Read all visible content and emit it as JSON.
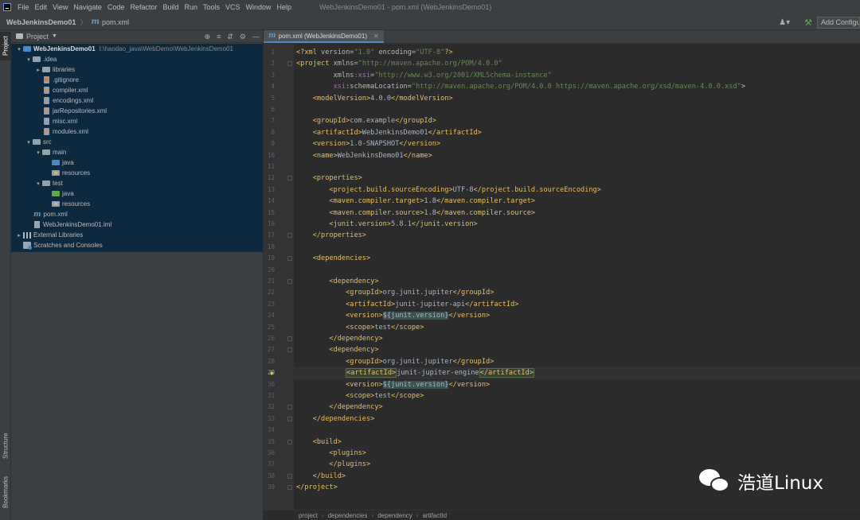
{
  "menu": [
    "File",
    "Edit",
    "View",
    "Navigate",
    "Code",
    "Refactor",
    "Build",
    "Run",
    "Tools",
    "VCS",
    "Window",
    "Help"
  ],
  "window_title": "WebJenkinsDemo01 - pom.xml (WebJenkinsDemo01)",
  "nav": {
    "project": "WebJenkinsDemo01",
    "separator": "〉",
    "file": "pom.xml",
    "add_config": "Add Configura"
  },
  "left_strip": {
    "project": "Project",
    "structure": "Structure",
    "bookmarks": "Bookmarks"
  },
  "project_panel": {
    "title": "Project",
    "tree": [
      {
        "label": "WebJenkinsDemo01",
        "path": "I:\\haodao_java\\WebDemo\\WebJenkinsDemo01",
        "indent": 0,
        "arrow": "down",
        "icon": "folder-blue",
        "bold": true
      },
      {
        "label": ".idea",
        "indent": 1,
        "arrow": "down",
        "icon": "folder-gray"
      },
      {
        "label": "libraries",
        "indent": 2,
        "arrow": "right",
        "icon": "folder-gray"
      },
      {
        "label": ".gitignore",
        "indent": 2,
        "arrow": "",
        "icon": "file-gitignore"
      },
      {
        "label": "compiler.xml",
        "indent": 2,
        "arrow": "",
        "icon": "file-xml"
      },
      {
        "label": "encodings.xml",
        "indent": 2,
        "arrow": "",
        "icon": "file-xml"
      },
      {
        "label": "jarRepositories.xml",
        "indent": 2,
        "arrow": "",
        "icon": "file-xml"
      },
      {
        "label": "misc.xml",
        "indent": 2,
        "arrow": "",
        "icon": "file-xml"
      },
      {
        "label": "modules.xml",
        "indent": 2,
        "arrow": "",
        "icon": "file-xml"
      },
      {
        "label": "src",
        "indent": 1,
        "arrow": "down",
        "icon": "folder-gray"
      },
      {
        "label": "main",
        "indent": 2,
        "arrow": "down",
        "icon": "folder-gray"
      },
      {
        "label": "java",
        "indent": 3,
        "arrow": "",
        "icon": "folder-blue"
      },
      {
        "label": "resources",
        "indent": 3,
        "arrow": "",
        "icon": "folder-resources"
      },
      {
        "label": "test",
        "indent": 2,
        "arrow": "down",
        "icon": "folder-gray"
      },
      {
        "label": "java",
        "indent": 3,
        "arrow": "",
        "icon": "folder-green"
      },
      {
        "label": "resources",
        "indent": 3,
        "arrow": "",
        "icon": "folder-resources"
      },
      {
        "label": "pom.xml",
        "indent": 1,
        "arrow": "",
        "icon": "maven-file"
      },
      {
        "label": "WebJenkinsDemo01.iml",
        "indent": 1,
        "arrow": "",
        "icon": "iml-file"
      },
      {
        "label": "External Libraries",
        "indent": 0,
        "arrow": "right",
        "icon": "library"
      },
      {
        "label": "Scratches and Consoles",
        "indent": 0,
        "arrow": "",
        "icon": "scratches"
      }
    ]
  },
  "editor": {
    "tab_label": "pom.xml (WebJenkinsDemo01)",
    "current_line": 29,
    "lines": [
      [
        [
          "t-tag",
          "<?xml "
        ],
        [
          "t-attr",
          "version"
        ],
        [
          "",
          "="
        ],
        [
          "t-val",
          "\"1.0\""
        ],
        [
          "t-attr",
          " encoding"
        ],
        [
          "",
          "="
        ],
        [
          "t-val",
          "\"UTF-8\""
        ],
        [
          "t-tag",
          "?>"
        ]
      ],
      [
        [
          "t-tag",
          "<project "
        ],
        [
          "t-attr",
          "xmlns"
        ],
        [
          "",
          "="
        ],
        [
          "t-val",
          "\"http://maven.apache.org/POM/4.0.0\""
        ]
      ],
      [
        [
          "",
          "         "
        ],
        [
          "t-attr",
          "xmlns"
        ],
        [
          "t-ns",
          ":xsi"
        ],
        [
          "",
          "="
        ],
        [
          "t-val",
          "\"http://www.w3.org/2001/XMLSchema-instance\""
        ]
      ],
      [
        [
          "",
          "         "
        ],
        [
          "t-ns",
          "xsi"
        ],
        [
          "t-attr",
          ":schemaLocation"
        ],
        [
          "",
          "="
        ],
        [
          "t-val",
          "\"http://maven.apache.org/POM/4.0.0 https://maven.apache.org/xsd/maven-4.0.0.xsd\""
        ],
        [
          "t-tag",
          ">"
        ]
      ],
      [
        [
          "",
          "    "
        ],
        [
          "t-tag",
          "<modelVersion>"
        ],
        [
          "",
          "4.0.0"
        ],
        [
          "t-tag",
          "</modelVersion>"
        ]
      ],
      [],
      [
        [
          "",
          "    "
        ],
        [
          "t-tag",
          "<groupId>"
        ],
        [
          "",
          "com.example"
        ],
        [
          "t-tag",
          "</groupId>"
        ]
      ],
      [
        [
          "",
          "    "
        ],
        [
          "t-tag",
          "<artifactId>"
        ],
        [
          "",
          "WebJenkinsDemo01"
        ],
        [
          "t-tag",
          "</artifactId>"
        ]
      ],
      [
        [
          "",
          "    "
        ],
        [
          "t-tag",
          "<version>"
        ],
        [
          "",
          "1.0-SNAPSHOT"
        ],
        [
          "t-tag",
          "</version>"
        ]
      ],
      [
        [
          "",
          "    "
        ],
        [
          "t-tag",
          "<name>"
        ],
        [
          "",
          "WebJenkinsDemo01"
        ],
        [
          "t-tag",
          "</name>"
        ]
      ],
      [],
      [
        [
          "",
          "    "
        ],
        [
          "t-tag",
          "<properties>"
        ]
      ],
      [
        [
          "",
          "        "
        ],
        [
          "t-tag",
          "<project.build.sourceEncoding>"
        ],
        [
          "",
          "UTF-8"
        ],
        [
          "t-tag",
          "</project.build.sourceEncoding>"
        ]
      ],
      [
        [
          "",
          "        "
        ],
        [
          "t-tag",
          "<maven.compiler.target>"
        ],
        [
          "",
          "1.8"
        ],
        [
          "t-tag",
          "</maven.compiler.target>"
        ]
      ],
      [
        [
          "",
          "        "
        ],
        [
          "t-tag",
          "<maven.compiler.source>"
        ],
        [
          "",
          "1.8"
        ],
        [
          "t-tag",
          "</maven.compiler.source>"
        ]
      ],
      [
        [
          "",
          "        "
        ],
        [
          "t-tag",
          "<junit.version>"
        ],
        [
          "",
          "5.8.1"
        ],
        [
          "t-tag",
          "</junit.version>"
        ]
      ],
      [
        [
          "",
          "    "
        ],
        [
          "t-tag",
          "</properties>"
        ]
      ],
      [],
      [
        [
          "",
          "    "
        ],
        [
          "t-tag",
          "<dependencies>"
        ]
      ],
      [],
      [
        [
          "",
          "        "
        ],
        [
          "t-tag",
          "<dependency>"
        ]
      ],
      [
        [
          "",
          "            "
        ],
        [
          "t-tag",
          "<groupId>"
        ],
        [
          "",
          "org.junit.jupiter"
        ],
        [
          "t-tag",
          "</groupId>"
        ]
      ],
      [
        [
          "",
          "            "
        ],
        [
          "t-tag",
          "<artifactId>"
        ],
        [
          "",
          "junit-jupiter-api"
        ],
        [
          "t-tag",
          "</artifactId>"
        ]
      ],
      [
        [
          "",
          "            "
        ],
        [
          "t-tag",
          "<version>"
        ],
        [
          "t-prop",
          "${junit.version}"
        ],
        [
          "t-tag",
          "</version>"
        ]
      ],
      [
        [
          "",
          "            "
        ],
        [
          "t-tag",
          "<scope>"
        ],
        [
          "",
          "test"
        ],
        [
          "t-tag",
          "</scope>"
        ]
      ],
      [
        [
          "",
          "        "
        ],
        [
          "t-tag",
          "</dependency>"
        ]
      ],
      [
        [
          "",
          "        "
        ],
        [
          "t-tag",
          "<dependency>"
        ]
      ],
      [
        [
          "",
          "            "
        ],
        [
          "t-tag",
          "<groupId>"
        ],
        [
          "",
          "org.junit.jupiter"
        ],
        [
          "t-tag",
          "</groupId>"
        ]
      ],
      [
        [
          "",
          "            "
        ],
        [
          "t-hl-tag",
          "<artifactId>"
        ],
        [
          "",
          "junit-jupiter-engine"
        ],
        [
          "t-hl-tag",
          "</artifactId>"
        ]
      ],
      [
        [
          "",
          "            "
        ],
        [
          "t-tag",
          "<version>"
        ],
        [
          "t-prop",
          "${junit.version}"
        ],
        [
          "t-tag",
          "</version>"
        ]
      ],
      [
        [
          "",
          "            "
        ],
        [
          "t-tag",
          "<scope>"
        ],
        [
          "",
          "test"
        ],
        [
          "t-tag",
          "</scope>"
        ]
      ],
      [
        [
          "",
          "        "
        ],
        [
          "t-tag",
          "</dependency>"
        ]
      ],
      [
        [
          "",
          "    "
        ],
        [
          "t-tag",
          "</dependencies>"
        ]
      ],
      [],
      [
        [
          "",
          "    "
        ],
        [
          "t-tag",
          "<build>"
        ]
      ],
      [
        [
          "",
          "        "
        ],
        [
          "t-tag",
          "<plugins>"
        ]
      ],
      [
        [
          "",
          "        "
        ],
        [
          "t-tag",
          "</plugins>"
        ]
      ],
      [
        [
          "",
          "    "
        ],
        [
          "t-tag",
          "</build>"
        ]
      ],
      [
        [
          "t-tag",
          "</project>"
        ]
      ]
    ],
    "breadcrumbs": [
      "project",
      "dependencies",
      "dependency",
      "artifactId"
    ]
  },
  "watermark": "浩道Linux"
}
